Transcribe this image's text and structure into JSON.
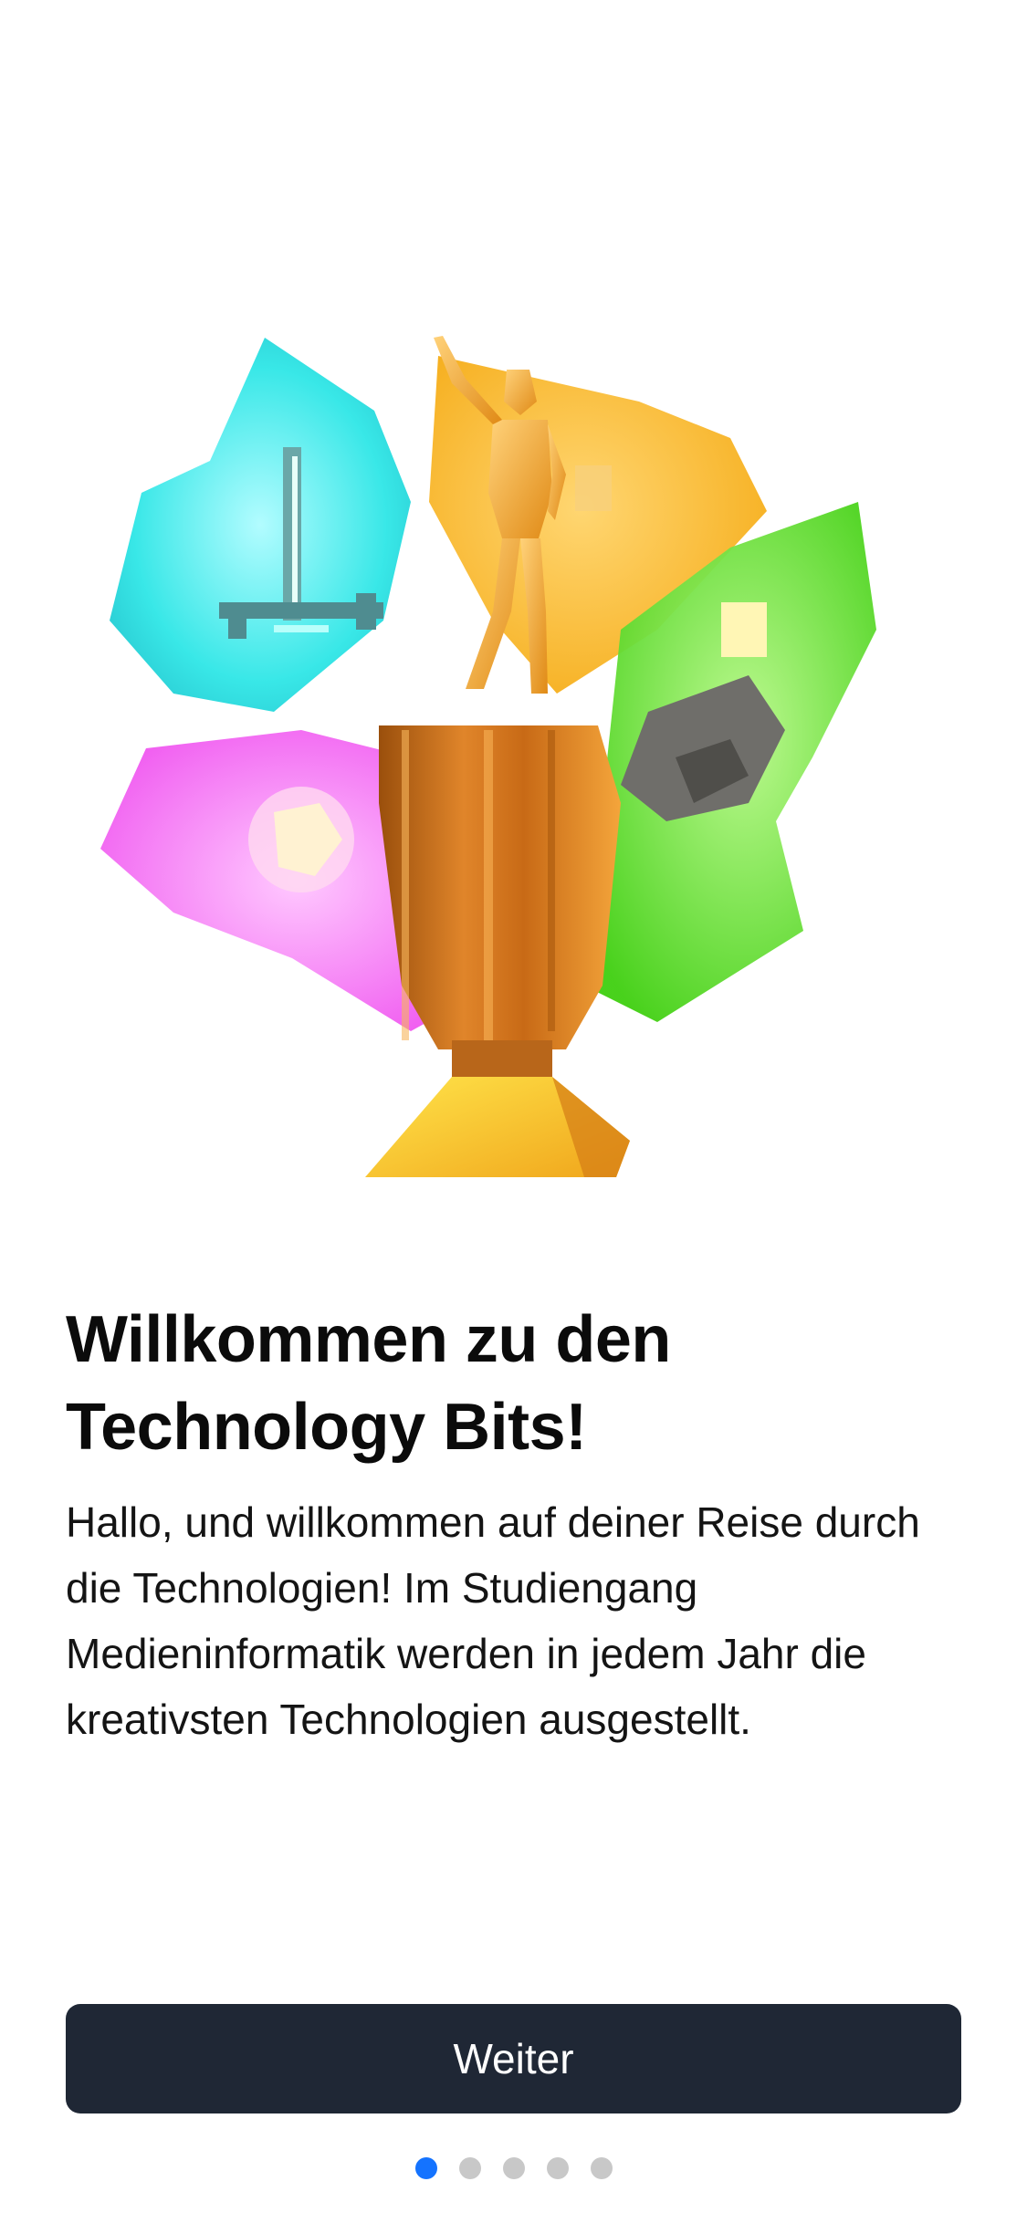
{
  "onboarding": {
    "title_line1": "Willkommen zu den",
    "title_line2": "Technology Bits!",
    "body": "Hallo, und willkommen auf deiner Reise durch die Technologien! Im Studiengang Medieninformatik werden in jedem Jahr die kreativsten Technologien ausgestellt.",
    "primary_button": "Weiter",
    "page_indicator": {
      "total": 5,
      "current": 1
    }
  },
  "colors": {
    "button_bg": "#1f2735",
    "active_dot": "#1473ff",
    "inactive_dot": "#c8c8c8",
    "shard_cyan": "#2ee6e6",
    "shard_yellow": "#f5b619",
    "shard_green": "#56dd1b",
    "shard_magenta": "#f05cf0",
    "trophy_gold": "#e9a525"
  },
  "hero_illustration": {
    "icon": "trophy-with-crystal-shards-illustration"
  }
}
